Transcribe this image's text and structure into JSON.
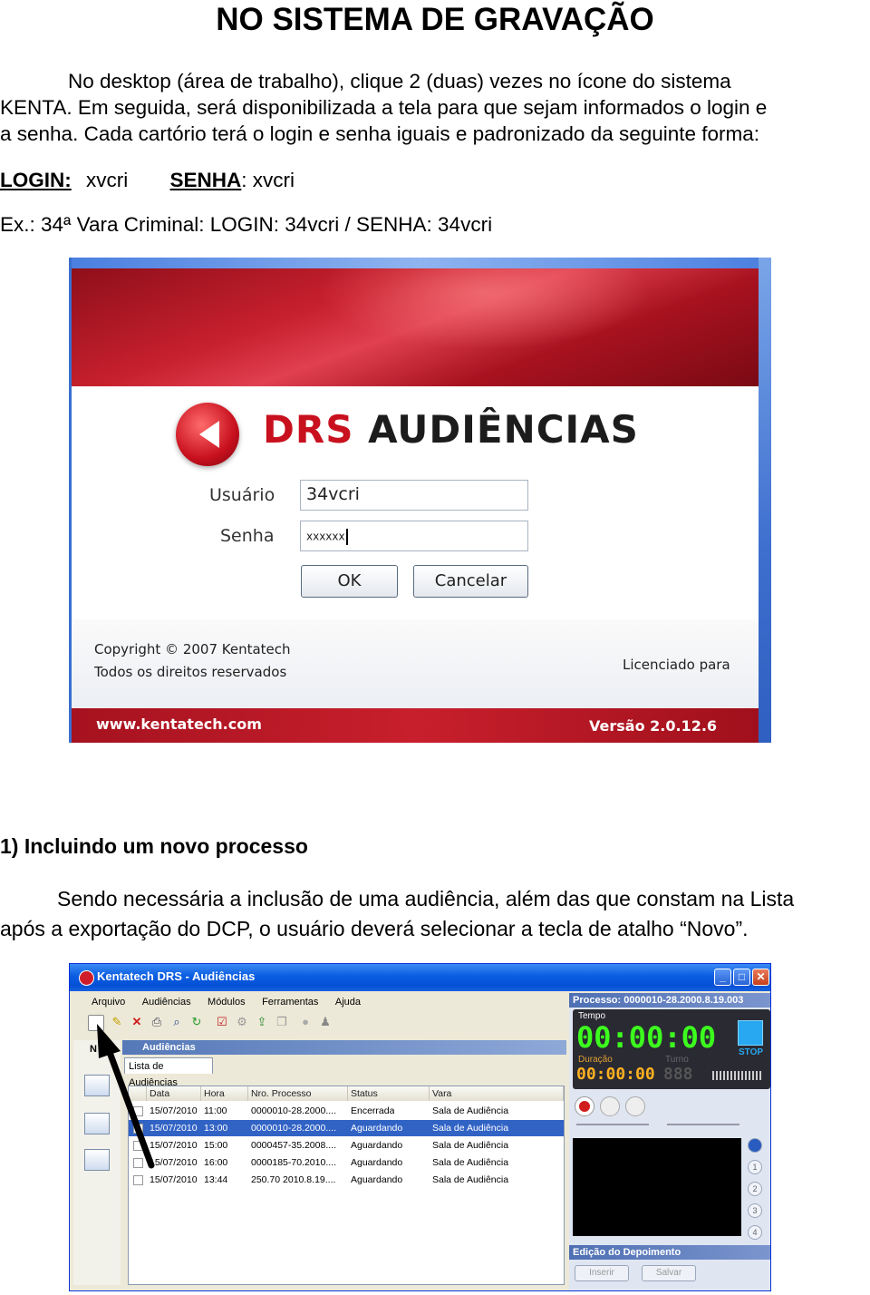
{
  "title": "NO SISTEMA DE GRAVAÇÃO",
  "intro": {
    "line1": "No desktop (área de trabalho), clique 2 (duas) vezes no ícone do sistema",
    "line2": "KENTA. Em seguida, será disponibilizada a tela para que sejam informados o login e",
    "line3": "a senha. Cada cartório terá o login e senha iguais e padronizado da seguinte forma:",
    "login_label": "LOGIN:",
    "login_value": "xvcri",
    "senha_label": "SENHA",
    "senha_value": ": xvcri",
    "example": "Ex.: 34ª Vara Criminal: LOGIN: 34vcri  /  SENHA: 34vcri"
  },
  "login_screen": {
    "brand_drs": "DRS",
    "brand_aud": "AUDIÊNCIAS",
    "usuario_label": "Usuário",
    "usuario_value": "34vcri",
    "senha_label": "Senha",
    "senha_value": "xxxxxx",
    "ok_label": "OK",
    "cancel_label": "Cancelar",
    "copyright1": "Copyright © 2007 Kentatech",
    "copyright2": "Todos os direitos reservados",
    "licensed": "Licenciado para",
    "website": "www.kentatech.com",
    "version": "Versão 2.0.12.6"
  },
  "section1": {
    "heading": "1) Incluindo um novo processo",
    "line1": "Sendo necessária a inclusão de uma audiência, além das que constam na Lista",
    "line2": "após a exportação do DCP, o usuário deverá selecionar a tecla de atalho “Novo”."
  },
  "app": {
    "window_title": "Kentatech DRS - Audiências",
    "menu": [
      "Arquivo",
      "Audiências",
      "Módulos",
      "Ferramentas",
      "Ajuda"
    ],
    "panel_title": "Audiências",
    "tab": "Lista de Audiências",
    "nav_letter": "N",
    "columns": [
      "Data",
      "Hora",
      "Nro. Processo",
      "Status",
      "Vara"
    ],
    "rows": [
      [
        "15/07/2010",
        "11:00",
        "0000010-28.2000....",
        "Encerrada",
        "Sala de Audiência"
      ],
      [
        "15/07/2010",
        "13:00",
        "0000010-28.2000....",
        "Aguardando",
        "Sala de Audiência"
      ],
      [
        "15/07/2010",
        "15:00",
        "0000457-35.2008....",
        "Aguardando",
        "Sala de Audiência"
      ],
      [
        "15/07/2010",
        "16:00",
        "0000185-70.2010....",
        "Aguardando",
        "Sala de Audiência"
      ],
      [
        "15/07/2010",
        "13:44",
        "250.70 2010.8.19....",
        "Aguardando",
        "Sala de Audiência"
      ]
    ],
    "selected_row": 1,
    "processo_label": "Processo:",
    "processo_value": "0000010-28.2000.8.19.003",
    "tempo_label": "Tempo",
    "tempo_value": "00:00:00",
    "stop_label": "STOP",
    "duracao_label": "Duração",
    "duracao_value": "00:00:00",
    "turno_label": "Turno",
    "turno_value": "888",
    "edicao_label": "Edição do Depoimento",
    "inserir_label": "Inserir",
    "salvar_label": "Salvar",
    "slots": [
      "1",
      "2",
      "3",
      "4"
    ],
    "accent": "#0a5ce0",
    "selection_color": "#3163c5",
    "digit_color": "#3cff1e"
  }
}
